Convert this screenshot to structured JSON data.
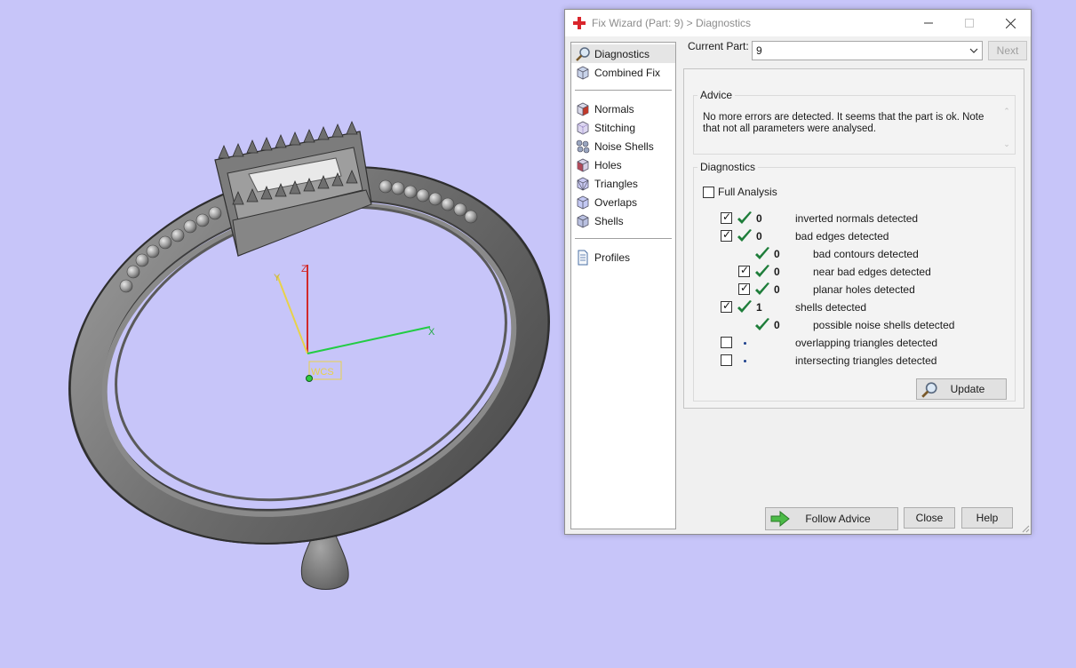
{
  "viewport": {
    "axes": {
      "x_label": "X",
      "y_label": "Y",
      "z_label": "Z",
      "wcs_label": "WCS"
    }
  },
  "dialog": {
    "title": "Fix Wizard (Part: 9) > Diagnostics",
    "nav": {
      "top": [
        {
          "label": "Diagnostics",
          "icon": "magnifier-icon",
          "active": true
        },
        {
          "label": "Combined Fix",
          "icon": "cube-icon"
        }
      ],
      "tools": [
        {
          "label": "Normals",
          "icon": "normals-cube-icon",
          "color": "#c0392b"
        },
        {
          "label": "Stitching",
          "icon": "stitching-cube-icon",
          "color": "#9b8bc7"
        },
        {
          "label": "Noise Shells",
          "icon": "noise-shells-icon",
          "color": "#7a8aa8"
        },
        {
          "label": "Holes",
          "icon": "holes-cube-icon",
          "color": "#b04a5a"
        },
        {
          "label": "Triangles",
          "icon": "triangles-cube-icon",
          "color": "#8f8fd8"
        },
        {
          "label": "Overlaps",
          "icon": "overlaps-cube-icon",
          "color": "#9aa3e6"
        },
        {
          "label": "Shells",
          "icon": "shells-cube-icon",
          "color": "#8a94c8"
        }
      ],
      "bottom": [
        {
          "label": "Profiles",
          "icon": "profiles-document-icon"
        }
      ]
    },
    "current_part_label": "Current Part:",
    "current_part_value": "9",
    "next_label": "Next",
    "advice": {
      "legend": "Advice",
      "text": "No more errors are detected. It seems that the part is ok. Note that not all parameters were analysed."
    },
    "diagnostics": {
      "legend": "Diagnostics",
      "full_analysis_label": "Full Analysis",
      "full_analysis_checked": false,
      "rows": [
        {
          "label": "inverted normals detected",
          "count": "0",
          "checked": true,
          "has_checkbox": true,
          "status": "ok",
          "indent": 0
        },
        {
          "label": "bad edges detected",
          "count": "0",
          "checked": true,
          "has_checkbox": true,
          "status": "ok",
          "indent": 0
        },
        {
          "label": "bad contours detected",
          "count": "0",
          "checked": false,
          "has_checkbox": false,
          "status": "ok",
          "indent": 1
        },
        {
          "label": "near bad edges detected",
          "count": "0",
          "checked": true,
          "has_checkbox": true,
          "status": "ok",
          "indent": 1
        },
        {
          "label": "planar holes detected",
          "count": "0",
          "checked": true,
          "has_checkbox": true,
          "status": "ok",
          "indent": 1
        },
        {
          "label": "shells detected",
          "count": "1",
          "checked": true,
          "has_checkbox": true,
          "status": "ok",
          "indent": 0
        },
        {
          "label": "possible noise shells detected",
          "count": "0",
          "checked": false,
          "has_checkbox": false,
          "status": "ok",
          "indent": 1
        },
        {
          "label": "overlapping triangles detected",
          "count": "",
          "checked": false,
          "has_checkbox": true,
          "status": "none",
          "indent": 0
        },
        {
          "label": "intersecting triangles detected",
          "count": "",
          "checked": false,
          "has_checkbox": true,
          "status": "none",
          "indent": 0
        }
      ],
      "update_label": "Update"
    },
    "buttons": {
      "follow_advice": "Follow Advice",
      "close": "Close",
      "help": "Help"
    }
  },
  "colors": {
    "background": "#c7c5f9",
    "ok_check": "#1e7d3a",
    "axis_x": "#22cc44",
    "axis_y": "#e8d24a",
    "axis_z": "#d22a2a"
  }
}
